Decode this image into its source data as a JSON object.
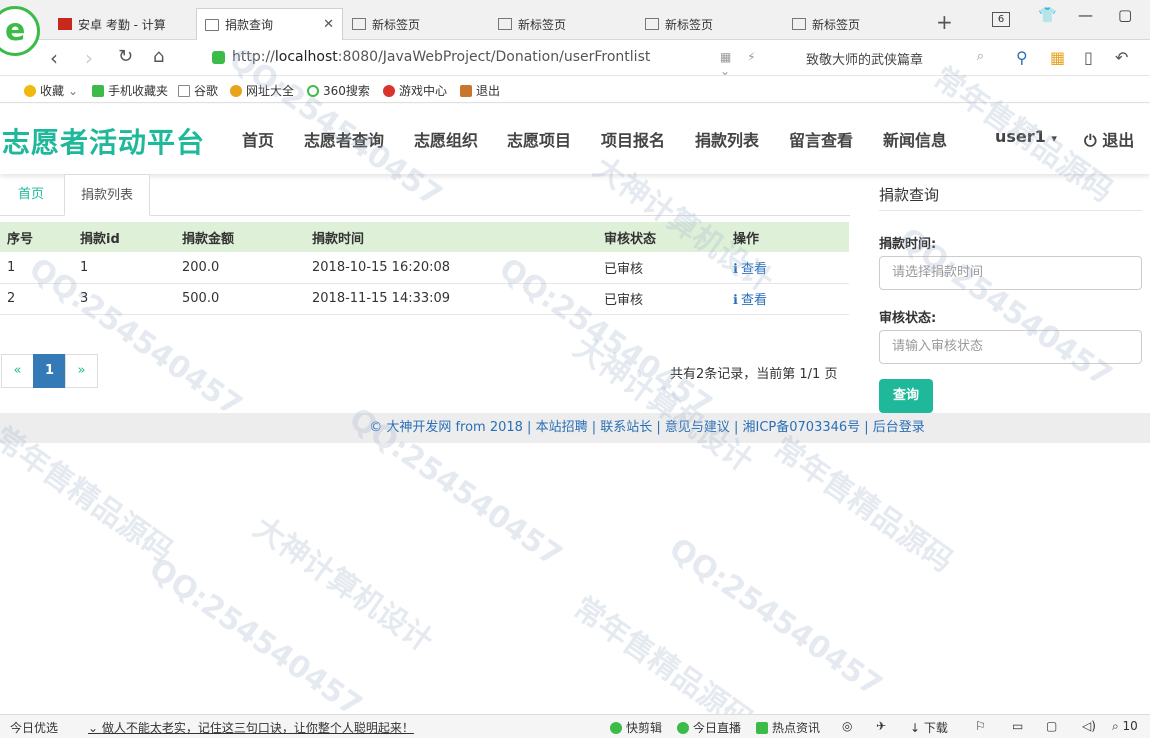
{
  "browser": {
    "tabs": [
      {
        "label": "安卓 考勤 - 计算"
      },
      {
        "label": "捐款查询"
      },
      {
        "label": "新标签页"
      },
      {
        "label": "新标签页"
      },
      {
        "label": "新标签页"
      },
      {
        "label": "新标签页"
      }
    ],
    "tab_count": "6",
    "url_prefix": "http://",
    "url_host": "localhost",
    "url_rest": ":8080/JavaWebProject/Donation/userFrontlist",
    "search_text": "致敬大师的武侠篇章",
    "bookmarks": [
      "收藏",
      "手机收藏夹",
      "谷歌",
      "网址大全",
      "360搜索",
      "游戏中心",
      "退出"
    ]
  },
  "site": {
    "brand": "志愿者活动平台",
    "nav": [
      "首页",
      "志愿者查询",
      "志愿组织",
      "志愿项目",
      "项目报名",
      "捐款列表",
      "留言查看",
      "新闻信息"
    ],
    "user": "user1",
    "logout": "退出"
  },
  "content_tabs": {
    "home": "首页",
    "current": "捐款列表"
  },
  "table": {
    "headers": [
      "序号",
      "捐款id",
      "捐款金额",
      "捐款时间",
      "审核状态",
      "操作"
    ],
    "rows": [
      {
        "no": "1",
        "id": "1",
        "amount": "200.0",
        "time": "2018-10-15 16:20:08",
        "status": "已审核",
        "action": "查看"
      },
      {
        "no": "2",
        "id": "3",
        "amount": "500.0",
        "time": "2018-11-15 14:33:09",
        "status": "已审核",
        "action": "查看"
      }
    ]
  },
  "pagination": {
    "prev": "«",
    "current": "1",
    "next": "»",
    "info": "共有2条记录，当前第 1/1 页"
  },
  "sidebar": {
    "title": "捐款查询",
    "time_label": "捐款时间:",
    "time_placeholder": "请选择捐款时间",
    "status_label": "审核状态:",
    "status_placeholder": "请输入审核状态",
    "query_button": "查询"
  },
  "footer": "© 大神开发网 from 2018 | 本站招聘 | 联系站长 | 意见与建议 | 湘ICP备0703346号 | 后台登录",
  "watermarks": [
    "QQ:254540457",
    "大神计算机设计",
    "常年售精品源码"
  ],
  "statusbar": {
    "left": "今日优选",
    "news": "做人不能太老实，记住这三句口诀，让你整个人聪明起来！",
    "items": [
      "快剪辑",
      "今日直播",
      "热点资讯",
      "下载"
    ],
    "zoom": "10"
  },
  "colors": {
    "brand": "#1fb89a",
    "table_header": "#dff0d8",
    "link": "#2a6fb7",
    "page_active": "#337ab7"
  }
}
